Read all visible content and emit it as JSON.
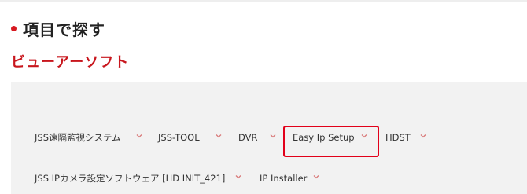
{
  "section": {
    "heading": "項目で探す"
  },
  "category": {
    "title": "ビューアーソフト"
  },
  "filters": {
    "row1": [
      {
        "label": "JSS遠隔監視システム"
      },
      {
        "label": "JSS-TOOL"
      },
      {
        "label": "DVR"
      },
      {
        "label": "Easy Ip Setup",
        "highlighted": true
      },
      {
        "label": "HDST"
      }
    ],
    "row2": [
      {
        "label": "JSS IPカメラ設定ソフトウェア [HD INIT_421]"
      },
      {
        "label": "IP Installer"
      }
    ]
  },
  "colors": {
    "accent": "#c8161d",
    "highlight_border": "#e2001a",
    "panel_background": "#f2f2f2",
    "underline": "#d98a8a",
    "chevron": "#d97a7a"
  },
  "icons": {
    "bullet": "bullet-dot-icon",
    "dropdown": "chevron-down-icon"
  }
}
